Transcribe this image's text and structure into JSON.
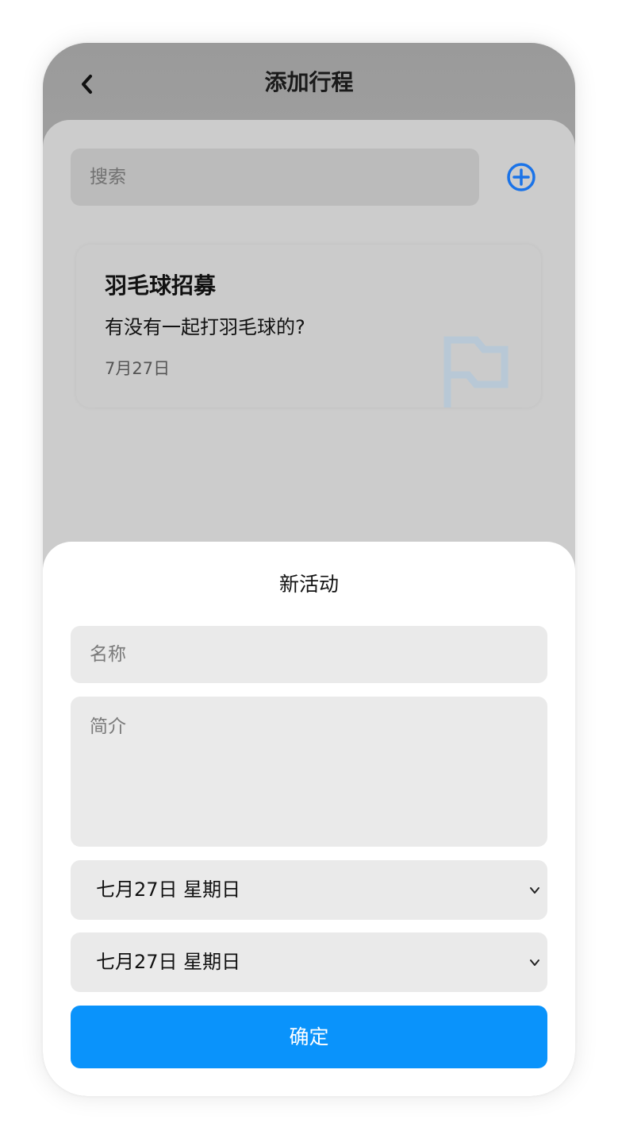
{
  "header": {
    "title": "添加行程",
    "back_icon": "chevron-left-icon"
  },
  "search": {
    "placeholder": "搜索",
    "add_icon": "plus-circle-icon",
    "accent_color": "#1a73e8"
  },
  "activities": [
    {
      "title": "羽毛球招募",
      "description": "有没有一起打羽毛球的?",
      "date": "7月27日",
      "icon": "flag-icon"
    }
  ],
  "new_activity_sheet": {
    "title": "新活动",
    "name_placeholder": "名称",
    "intro_placeholder": "简介",
    "start_date": "七月27日 星期日",
    "end_date": "七月27日 星期日",
    "confirm_label": "确定",
    "confirm_color": "#0a93fb"
  }
}
